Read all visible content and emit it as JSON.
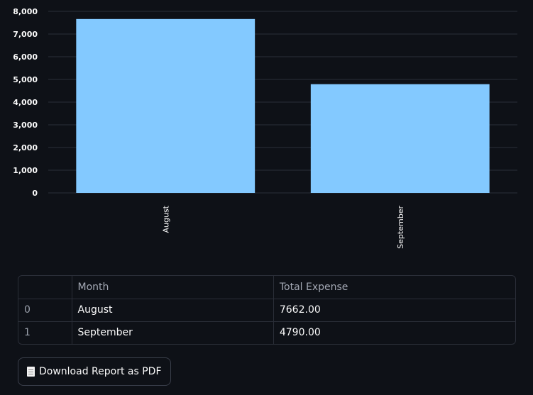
{
  "chart_data": {
    "type": "bar",
    "categories": [
      "August",
      "September"
    ],
    "values": [
      7662,
      4790
    ],
    "ylim": [
      0,
      8000
    ],
    "yticks": [
      0,
      1000,
      2000,
      3000,
      4000,
      5000,
      6000,
      7000,
      8000
    ],
    "ytick_labels": [
      "0",
      "1,000",
      "2,000",
      "3,000",
      "4,000",
      "5,000",
      "6,000",
      "7,000",
      "8,000"
    ],
    "grid": true,
    "bar_color": "#83c9ff",
    "title": "",
    "xlabel": "",
    "ylabel": ""
  },
  "table": {
    "columns": [
      "",
      "Month",
      "Total Expense"
    ],
    "rows": [
      {
        "index": "0",
        "month": "August",
        "total": "7662.00"
      },
      {
        "index": "1",
        "month": "September",
        "total": "4790.00"
      }
    ]
  },
  "download_button": {
    "icon": "document-icon",
    "label": "Download Report as PDF"
  },
  "colors": {
    "background": "#0e1117",
    "bar": "#83c9ff",
    "grid": "#2a2e38"
  }
}
